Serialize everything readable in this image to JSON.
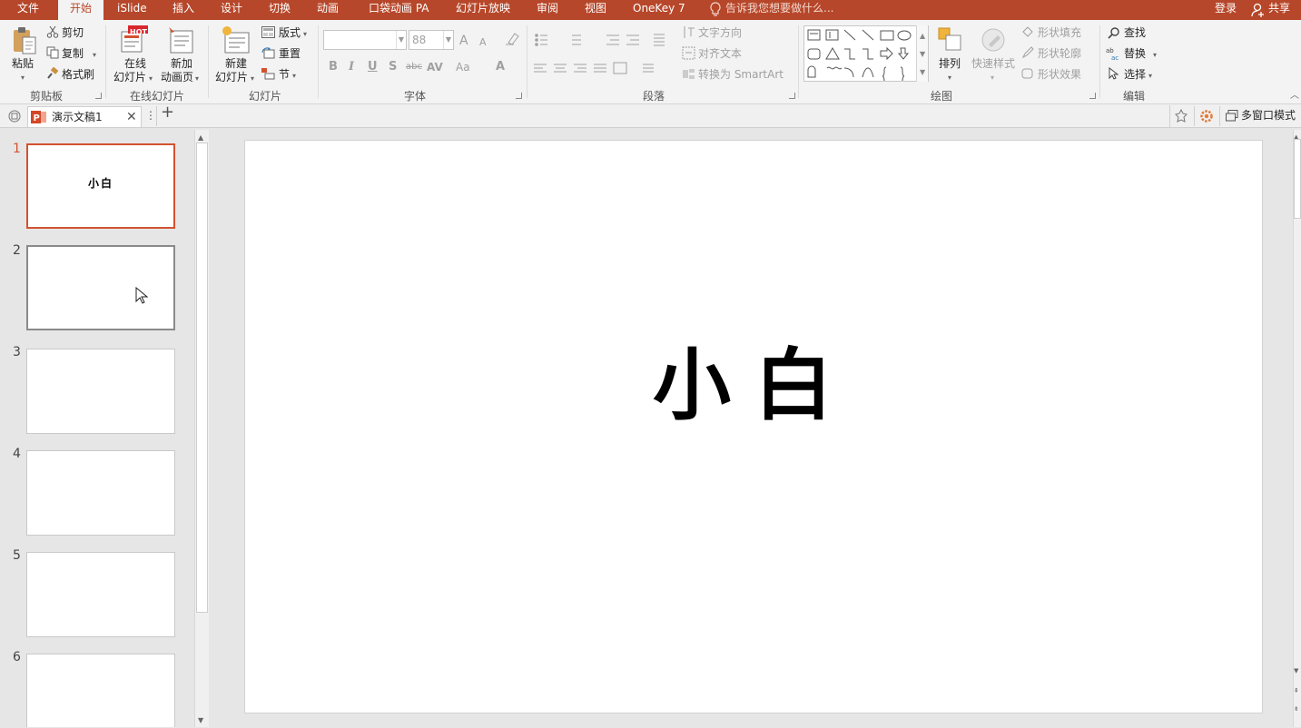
{
  "app": {
    "accent_color": "#b7472a",
    "selected_color": "#d35230"
  },
  "menubar": {
    "tabs": [
      {
        "label": "文件"
      },
      {
        "label": "开始"
      },
      {
        "label": "iSlide"
      },
      {
        "label": "插入"
      },
      {
        "label": "设计"
      },
      {
        "label": "切换"
      },
      {
        "label": "动画"
      },
      {
        "label": "口袋动画 PA"
      },
      {
        "label": "幻灯片放映"
      },
      {
        "label": "审阅"
      },
      {
        "label": "视图"
      },
      {
        "label": "OneKey 7"
      }
    ],
    "active_tab": "开始",
    "tell_me": "告诉我您想要做什么...",
    "login": "登录",
    "share": "共享"
  },
  "ribbon": {
    "clipboard": {
      "group_label": "剪贴板",
      "paste": "粘贴",
      "cut": "剪切",
      "copy": "复制",
      "format_painter": "格式刷"
    },
    "online_slides": {
      "group_label": "在线幻灯片",
      "online_line1": "在线",
      "online_line2": "幻灯片",
      "hot_badge": "HOT",
      "new_anim_line1": "新加",
      "new_anim_line2": "动画页"
    },
    "slides": {
      "group_label": "幻灯片",
      "new_line1": "新建",
      "new_line2": "幻灯片",
      "layout": "版式",
      "reset": "重置",
      "section": "节"
    },
    "font": {
      "group_label": "字体",
      "font_name": "",
      "font_size": "88",
      "bold": "B",
      "italic": "I",
      "underline": "U",
      "shadow": "S",
      "strike": "abc",
      "spacing": "AV",
      "case": "Aa",
      "color": "A",
      "grow": "A",
      "shrink": "A"
    },
    "paragraph": {
      "group_label": "段落",
      "text_direction": "文字方向",
      "align_text": "对齐文本",
      "convert_smartart": "转换为 SmartArt"
    },
    "drawing": {
      "group_label": "绘图",
      "arrange": "排列",
      "quick_styles": "快速样式",
      "shape_fill": "形状填充",
      "shape_outline": "形状轮廓",
      "shape_effects": "形状效果"
    },
    "editing": {
      "group_label": "编辑",
      "find": "查找",
      "replace": "替换",
      "select": "选择"
    }
  },
  "document_tab": {
    "title": "演示文稿1",
    "right_label": "多窗口模式"
  },
  "slides": [
    {
      "number": "1",
      "title": "小白"
    },
    {
      "number": "2",
      "title": ""
    },
    {
      "number": "3",
      "title": ""
    },
    {
      "number": "4",
      "title": ""
    },
    {
      "number": "5",
      "title": ""
    },
    {
      "number": "6",
      "title": ""
    }
  ],
  "current_slide": {
    "title": "小白"
  }
}
